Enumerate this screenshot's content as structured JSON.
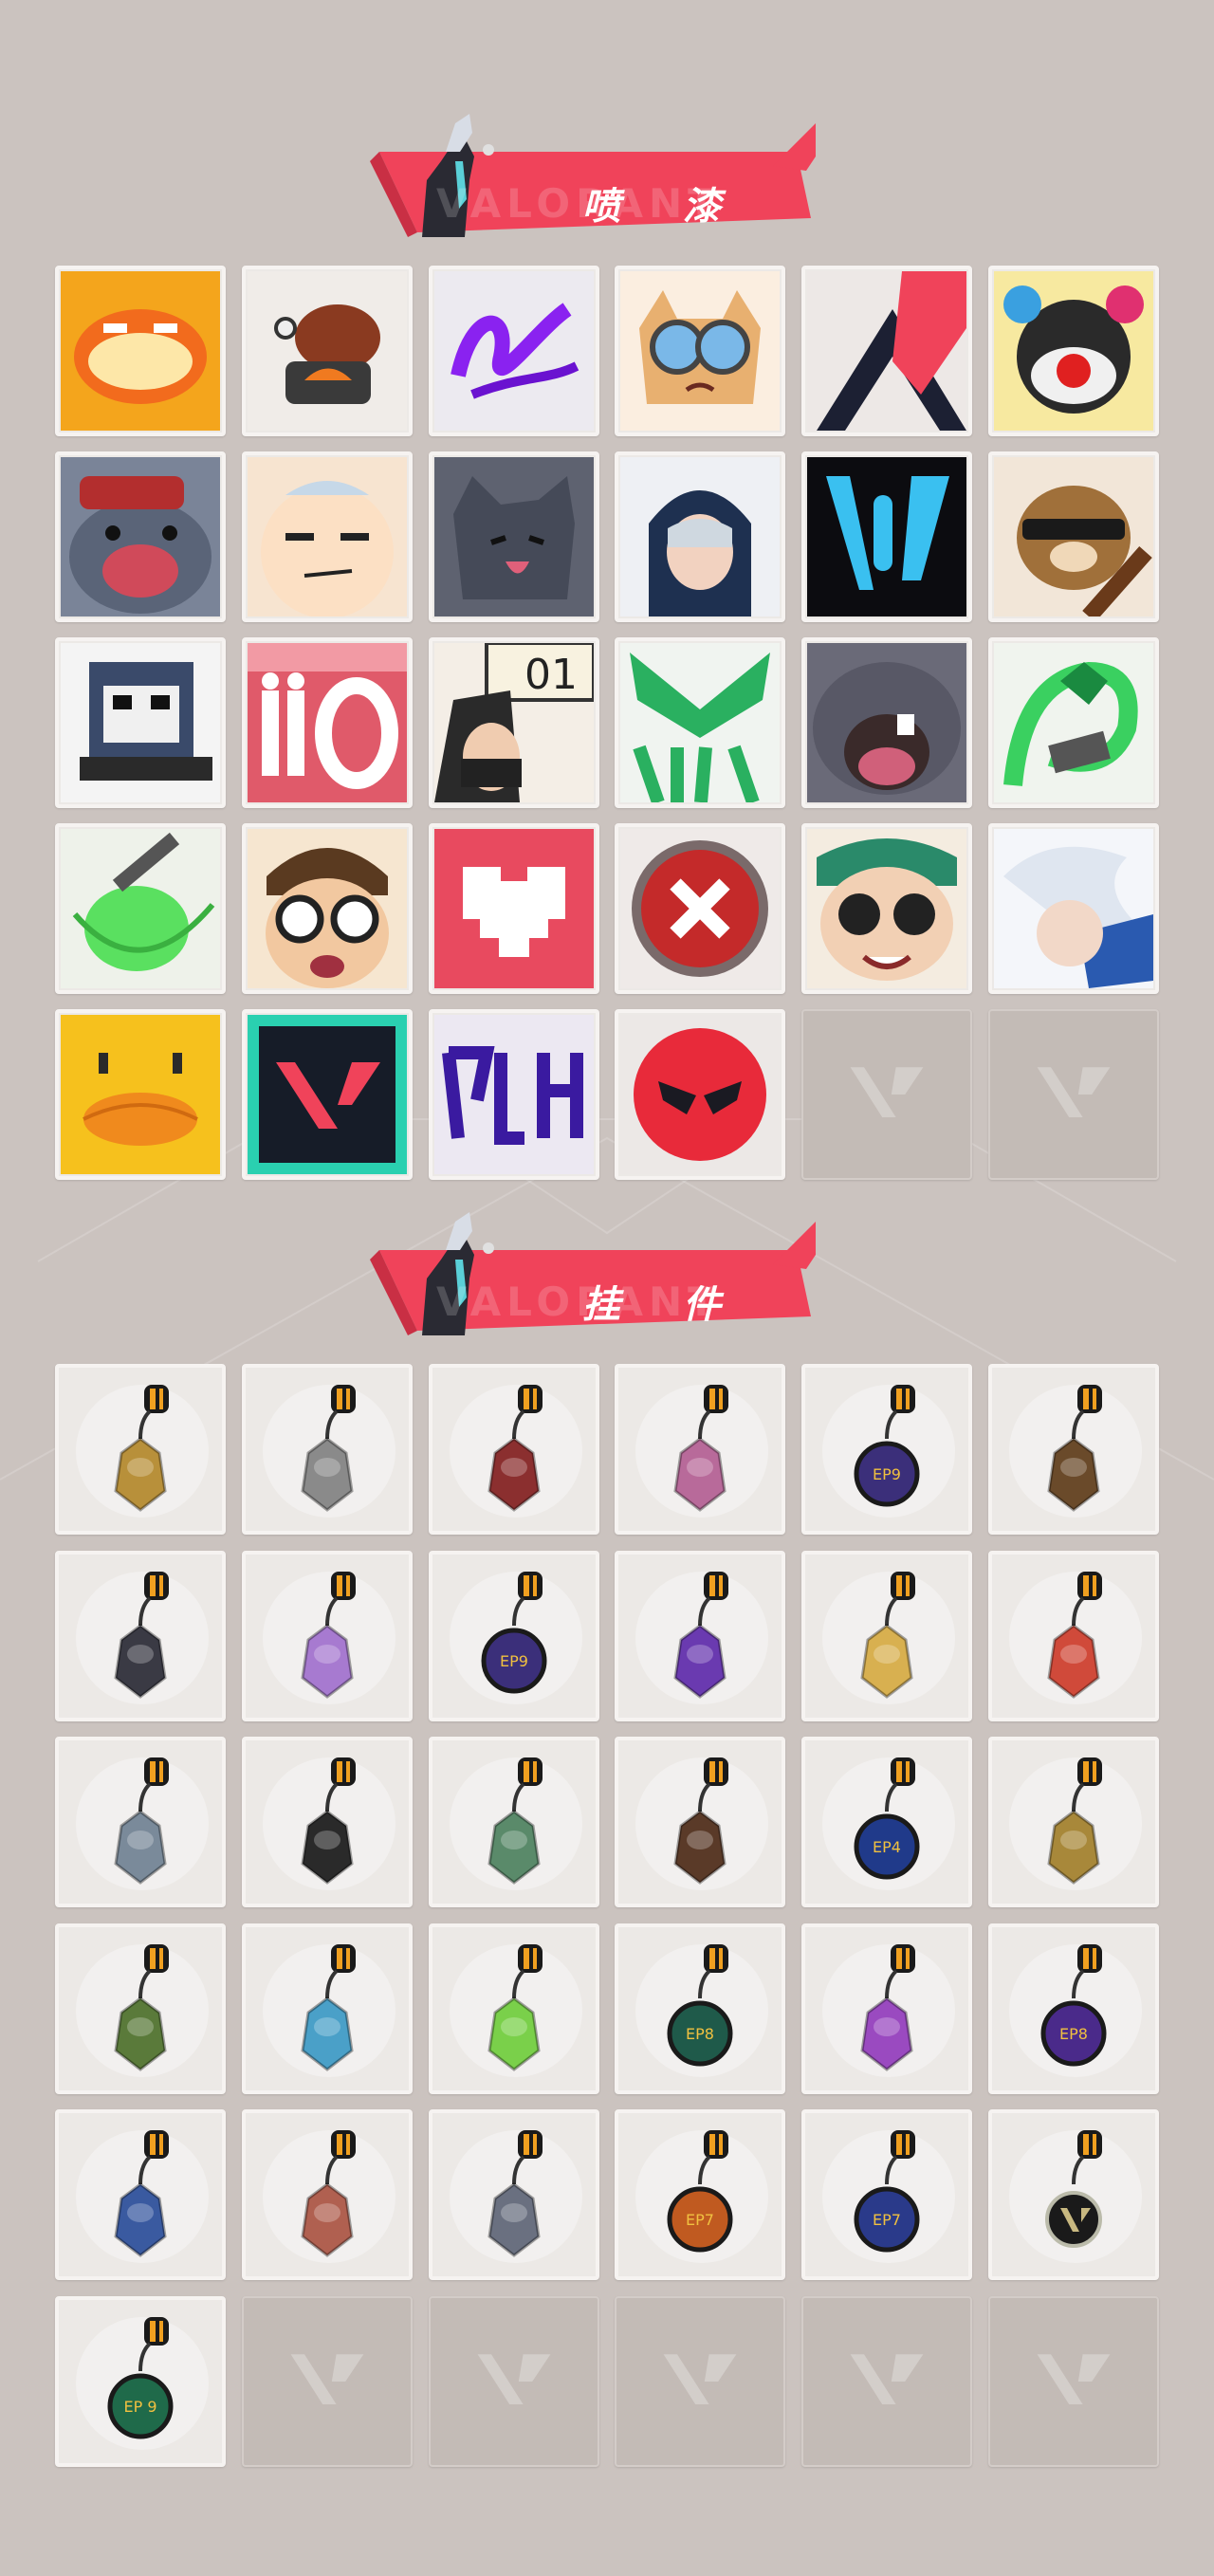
{
  "sections": {
    "sprays": {
      "title": "喷 漆",
      "wordmark": "VALORANT"
    },
    "buddies": {
      "title": "挂 件",
      "wordmark": "VALORANT"
    }
  },
  "colors": {
    "background": "#cbc3bf",
    "accent": "#f0435a",
    "tile": "#ece9e6",
    "empty_tile": "#c3bbb6"
  },
  "sprays": [
    {
      "icon": "orange-blob-face-spray"
    },
    {
      "icon": "roast-meat-spray"
    },
    {
      "icon": "purple-graffiti-spray"
    },
    {
      "icon": "goggles-cat-spray"
    },
    {
      "icon": "chevron-logo-spray"
    },
    {
      "icon": "clown-face-spray"
    },
    {
      "icon": "crying-seal-spray"
    },
    {
      "icon": "smug-face-spray"
    },
    {
      "icon": "gray-cat-spray"
    },
    {
      "icon": "hooded-agent-spray"
    },
    {
      "icon": "blue-drip-logo-spray"
    },
    {
      "icon": "sunglasses-bear-guitar-spray"
    },
    {
      "icon": "pixel-sloth-spray"
    },
    {
      "icon": "ammo-counter-spray"
    },
    {
      "icon": "number-sign-agent-spray"
    },
    {
      "icon": "viper-green-spray"
    },
    {
      "icon": "screaming-seal-spray"
    },
    {
      "icon": "green-snake-spray"
    },
    {
      "icon": "green-orb-spray"
    },
    {
      "icon": "glasses-kid-spray"
    },
    {
      "icon": "pixel-heart-spray"
    },
    {
      "icon": "red-x-button-spray"
    },
    {
      "icon": "smiling-girl-spray"
    },
    {
      "icon": "white-hair-agent-spray"
    },
    {
      "icon": "yellow-duck-spray"
    },
    {
      "icon": "valorant-logo-splash-spray"
    },
    {
      "icon": "purple-tag-graffiti-spray"
    },
    {
      "icon": "red-angry-face-spray"
    },
    {
      "icon": "empty-slot"
    },
    {
      "icon": "empty-slot"
    }
  ],
  "buddies": [
    {
      "icon": "golden-cat-buddy",
      "color": "#b8903a"
    },
    {
      "icon": "treasure-box-buddy",
      "color": "#8a8a8a"
    },
    {
      "icon": "red-rope-knot-buddy",
      "color": "#8b2f2f"
    },
    {
      "icon": "cupcake-buddy",
      "color": "#b86a9a"
    },
    {
      "icon": "ep9-medal-buddy",
      "color": "#3b2f7a"
    },
    {
      "icon": "wooden-gun-buddy",
      "color": "#6a4a2a"
    },
    {
      "icon": "black-dragon-buddy",
      "color": "#3a3a44"
    },
    {
      "icon": "lava-lamp-buddy",
      "color": "#a77ad0"
    },
    {
      "icon": "ep9-medal-buddy",
      "color": "#3b2f7a"
    },
    {
      "icon": "purple-pixel-heart-buddy",
      "color": "#6a3ab0"
    },
    {
      "icon": "taco-buddy",
      "color": "#d8b050"
    },
    {
      "icon": "skewer-buddy",
      "color": "#d04a3a"
    },
    {
      "icon": "agent-keychain-buddy",
      "color": "#7a8a9a"
    },
    {
      "icon": "microphone-buddy",
      "color": "#2a2a2a"
    },
    {
      "icon": "robot-chest-buddy",
      "color": "#5a8a6a"
    },
    {
      "icon": "lute-buddy",
      "color": "#5a3a28"
    },
    {
      "icon": "ep9-blue-medal-buddy",
      "color": "#203a8a"
    },
    {
      "icon": "golden-robot-buddy",
      "color": "#a8883a"
    },
    {
      "icon": "green-mask-buddy",
      "color": "#5a7a3a"
    },
    {
      "icon": "blue-dagger-buddy",
      "color": "#4aa0c8"
    },
    {
      "icon": "green-lantern-buddy",
      "color": "#7ad04a"
    },
    {
      "icon": "ep8-green-medal-buddy",
      "color": "#1f5a4a"
    },
    {
      "icon": "lotus-flame-buddy",
      "color": "#9a4ac0"
    },
    {
      "icon": "ep8-purple-medal-buddy",
      "color": "#4a2a8a"
    },
    {
      "icon": "ufo-buddy",
      "color": "#3a5aa0"
    },
    {
      "icon": "fish-buddy",
      "color": "#b06050"
    },
    {
      "icon": "gray-pig-buddy",
      "color": "#6a7080"
    },
    {
      "icon": "ep7-orange-medal-buddy",
      "color": "#c05a20"
    },
    {
      "icon": "ep7-blue-medal-buddy",
      "color": "#2a3a8a"
    },
    {
      "icon": "valorant-logo-medal-buddy",
      "color": "#222222"
    },
    {
      "icon": "ep9-green-gem-buddy",
      "color": "#1f6a4a"
    },
    {
      "icon": "empty-slot"
    },
    {
      "icon": "empty-slot"
    },
    {
      "icon": "empty-slot"
    },
    {
      "icon": "empty-slot"
    },
    {
      "icon": "empty-slot"
    }
  ],
  "buddy_labels": {
    "ep9-medal-buddy": "EP9",
    "ep9-blue-medal-buddy": "EP4",
    "ep8-green-medal-buddy": "EP8",
    "ep8-purple-medal-buddy": "EP8",
    "ep7-orange-medal-buddy": "EP7",
    "ep7-blue-medal-buddy": "EP7",
    "ep9-green-gem-buddy": "EP 9"
  }
}
